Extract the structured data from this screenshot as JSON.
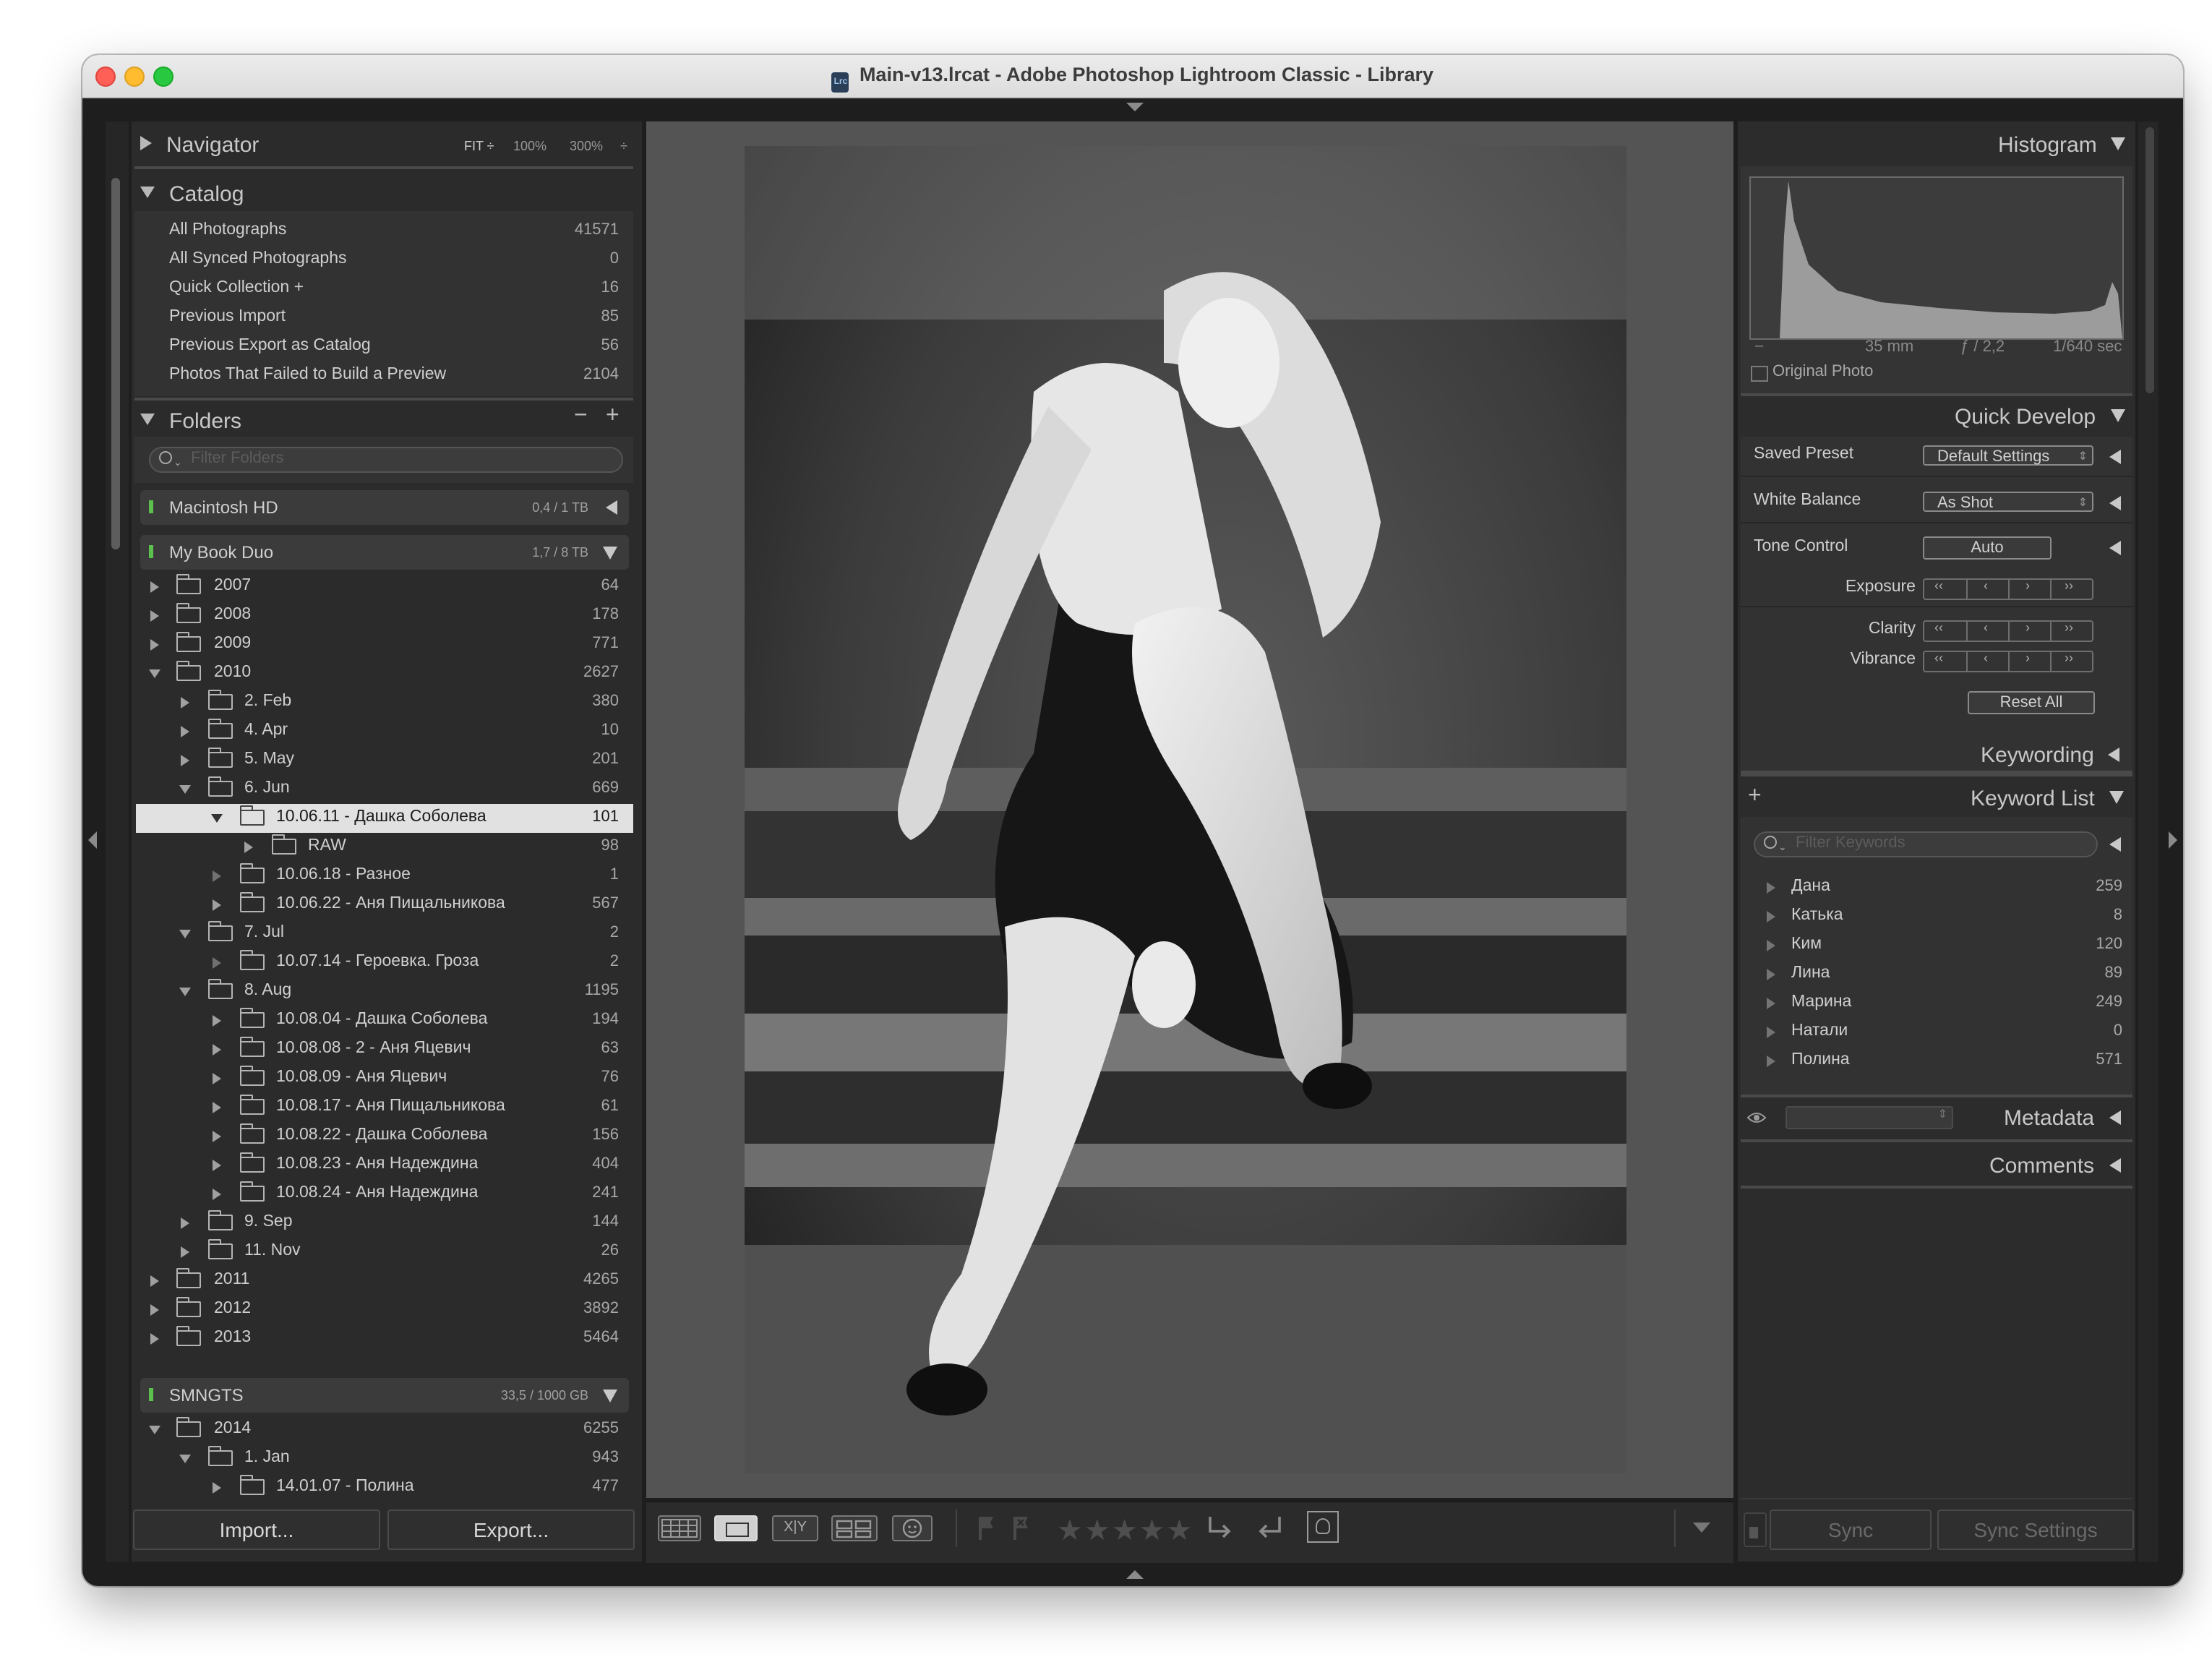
{
  "window": {
    "title": "Main-v13.lrcat - Adobe Photoshop Lightroom Classic - Library",
    "app_icon": "Lrc"
  },
  "navigator": {
    "title": "Navigator",
    "zoom_fit": "FIT ÷",
    "zoom_100": "100%",
    "zoom_300": "300%",
    "zoom_more": "÷"
  },
  "catalog": {
    "title": "Catalog",
    "items": [
      {
        "label": "All Photographs",
        "count": "41571"
      },
      {
        "label": "All Synced Photographs",
        "count": "0"
      },
      {
        "label": "Quick Collection +",
        "count": "16"
      },
      {
        "label": "Previous Import",
        "count": "85"
      },
      {
        "label": "Previous Export as Catalog",
        "count": "56"
      },
      {
        "label": "Photos That Failed to Build a Preview",
        "count": "2104"
      }
    ]
  },
  "folders": {
    "title": "Folders",
    "minus": "−",
    "plus": "+",
    "filter_placeholder": "Filter Folders",
    "volumes": [
      {
        "label": "Macintosh HD",
        "size": "0,4 / 1 TB"
      },
      {
        "label": "My Book Duo",
        "size": "1,7 / 8 TB"
      },
      {
        "label": "SMNGTS",
        "size": "33,5 / 1000 GB"
      }
    ],
    "rows": [
      {
        "label": "2007",
        "count": "64"
      },
      {
        "label": "2008",
        "count": "178"
      },
      {
        "label": "2009",
        "count": "771"
      },
      {
        "label": "2010",
        "count": "2627"
      },
      {
        "label": "2. Feb",
        "count": "380"
      },
      {
        "label": "4. Apr",
        "count": "10"
      },
      {
        "label": "5. May",
        "count": "201"
      },
      {
        "label": "6. Jun",
        "count": "669"
      },
      {
        "label": "10.06.11 - Дашка Соболева",
        "count": "101"
      },
      {
        "label": "RAW",
        "count": "98"
      },
      {
        "label": "10.06.18 - Разное",
        "count": "1"
      },
      {
        "label": "10.06.22 - Аня Пищальникова",
        "count": "567"
      },
      {
        "label": "7. Jul",
        "count": "2"
      },
      {
        "label": "10.07.14 - Героевка. Гроза",
        "count": "2"
      },
      {
        "label": "8. Aug",
        "count": "1195"
      },
      {
        "label": "10.08.04 - Дашка Соболева",
        "count": "194"
      },
      {
        "label": "10.08.08 - 2 - Аня Яцевич",
        "count": "63"
      },
      {
        "label": "10.08.09 - Аня Яцевич",
        "count": "76"
      },
      {
        "label": "10.08.17 - Аня Пищальникова",
        "count": "61"
      },
      {
        "label": "10.08.22 - Дашка Соболева",
        "count": "156"
      },
      {
        "label": "10.08.23 - Аня Надеждина",
        "count": "404"
      },
      {
        "label": "10.08.24 - Аня Надеждина",
        "count": "241"
      },
      {
        "label": "9. Sep",
        "count": "144"
      },
      {
        "label": "11. Nov",
        "count": "26"
      },
      {
        "label": "2011",
        "count": "4265"
      },
      {
        "label": "2012",
        "count": "3892"
      },
      {
        "label": "2013",
        "count": "5464"
      },
      {
        "label": "2014",
        "count": "6255"
      },
      {
        "label": "1. Jan",
        "count": "943"
      },
      {
        "label": "14.01.07 - Полина",
        "count": "477"
      }
    ]
  },
  "import_label": "Import...",
  "export_label": "Export...",
  "histogram": {
    "title": "Histogram",
    "dash": "–",
    "focal": "35 mm",
    "aperture": "ƒ / 2,2",
    "shutter": "1/640 sec",
    "original_photo": "Original Photo"
  },
  "quick_develop": {
    "title": "Quick Develop",
    "saved_preset_label": "Saved Preset",
    "saved_preset_value": "Default Settings",
    "white_balance_label": "White Balance",
    "white_balance_value": "As Shot",
    "tone_control_label": "Tone Control",
    "auto_label": "Auto",
    "exposure_label": "Exposure",
    "clarity_label": "Clarity",
    "vibrance_label": "Vibrance",
    "reset_all_label": "Reset All"
  },
  "keywording": {
    "title": "Keywording"
  },
  "keyword_list": {
    "title": "Keyword List",
    "plus": "+",
    "filter_placeholder": "Filter Keywords",
    "items": [
      {
        "label": "Дана",
        "count": "259"
      },
      {
        "label": "Катька",
        "count": "8"
      },
      {
        "label": "Ким",
        "count": "120"
      },
      {
        "label": "Лина",
        "count": "89"
      },
      {
        "label": "Марина",
        "count": "249"
      },
      {
        "label": "Натали",
        "count": "0"
      },
      {
        "label": "Полина",
        "count": "571"
      }
    ]
  },
  "metadata": {
    "title": "Metadata"
  },
  "comments": {
    "title": "Comments"
  },
  "sync_label": "Sync",
  "sync_settings_label": "Sync Settings",
  "toolbar": {
    "compare_label": "X|Y",
    "stars": "★★★★★"
  }
}
